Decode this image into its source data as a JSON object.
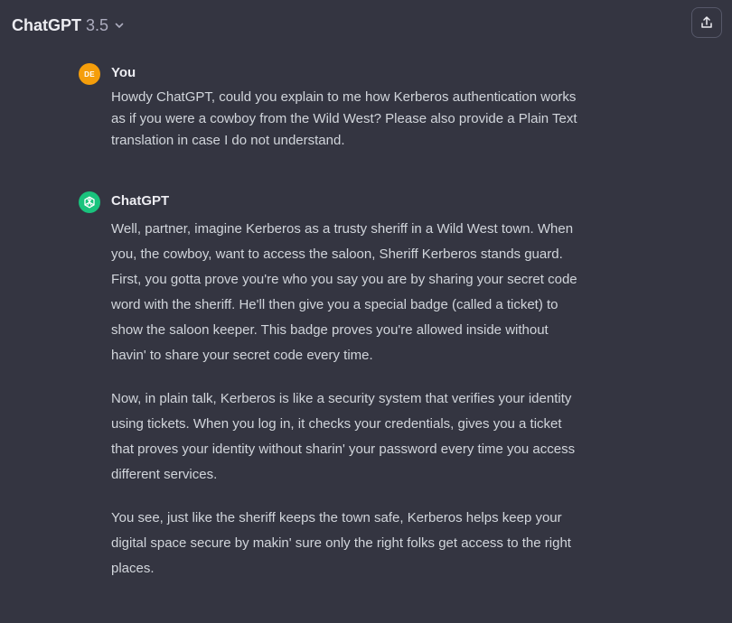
{
  "header": {
    "model_name": "ChatGPT",
    "model_version": "3.5",
    "dropdown_icon": "chevron-down-icon",
    "share_icon": "share-icon"
  },
  "conversation": {
    "user_message": {
      "avatar_initials": "DE",
      "avatar_color": "#f59e0b",
      "author": "You",
      "text": "Howdy ChatGPT, could you explain to me how Kerberos authentication works as if you were a cowboy from the Wild West? Please also provide a Plain Text translation in case I do not understand."
    },
    "assistant_message": {
      "avatar_icon": "openai-logo-icon",
      "avatar_color": "#19c37d",
      "author": "ChatGPT",
      "paragraphs": [
        "Well, partner, imagine Kerberos as a trusty sheriff in a Wild West town. When you, the cowboy, want to access the saloon, Sheriff Kerberos stands guard. First, you gotta prove you're who you say you are by sharing your secret code word with the sheriff. He'll then give you a special badge (called a ticket) to show the saloon keeper. This badge proves you're allowed inside without havin' to share your secret code every time.",
        "Now, in plain talk, Kerberos is like a security system that verifies your identity using tickets. When you log in, it checks your credentials, gives you a ticket that proves your identity without sharin' your password every time you access different services.",
        "You see, just like the sheriff keeps the town safe, Kerberos helps keep your digital space secure by makin' sure only the right folks get access to the right places."
      ]
    }
  },
  "colors": {
    "background": "#343541",
    "text": "#d1d5db",
    "heading": "#ececf1"
  }
}
